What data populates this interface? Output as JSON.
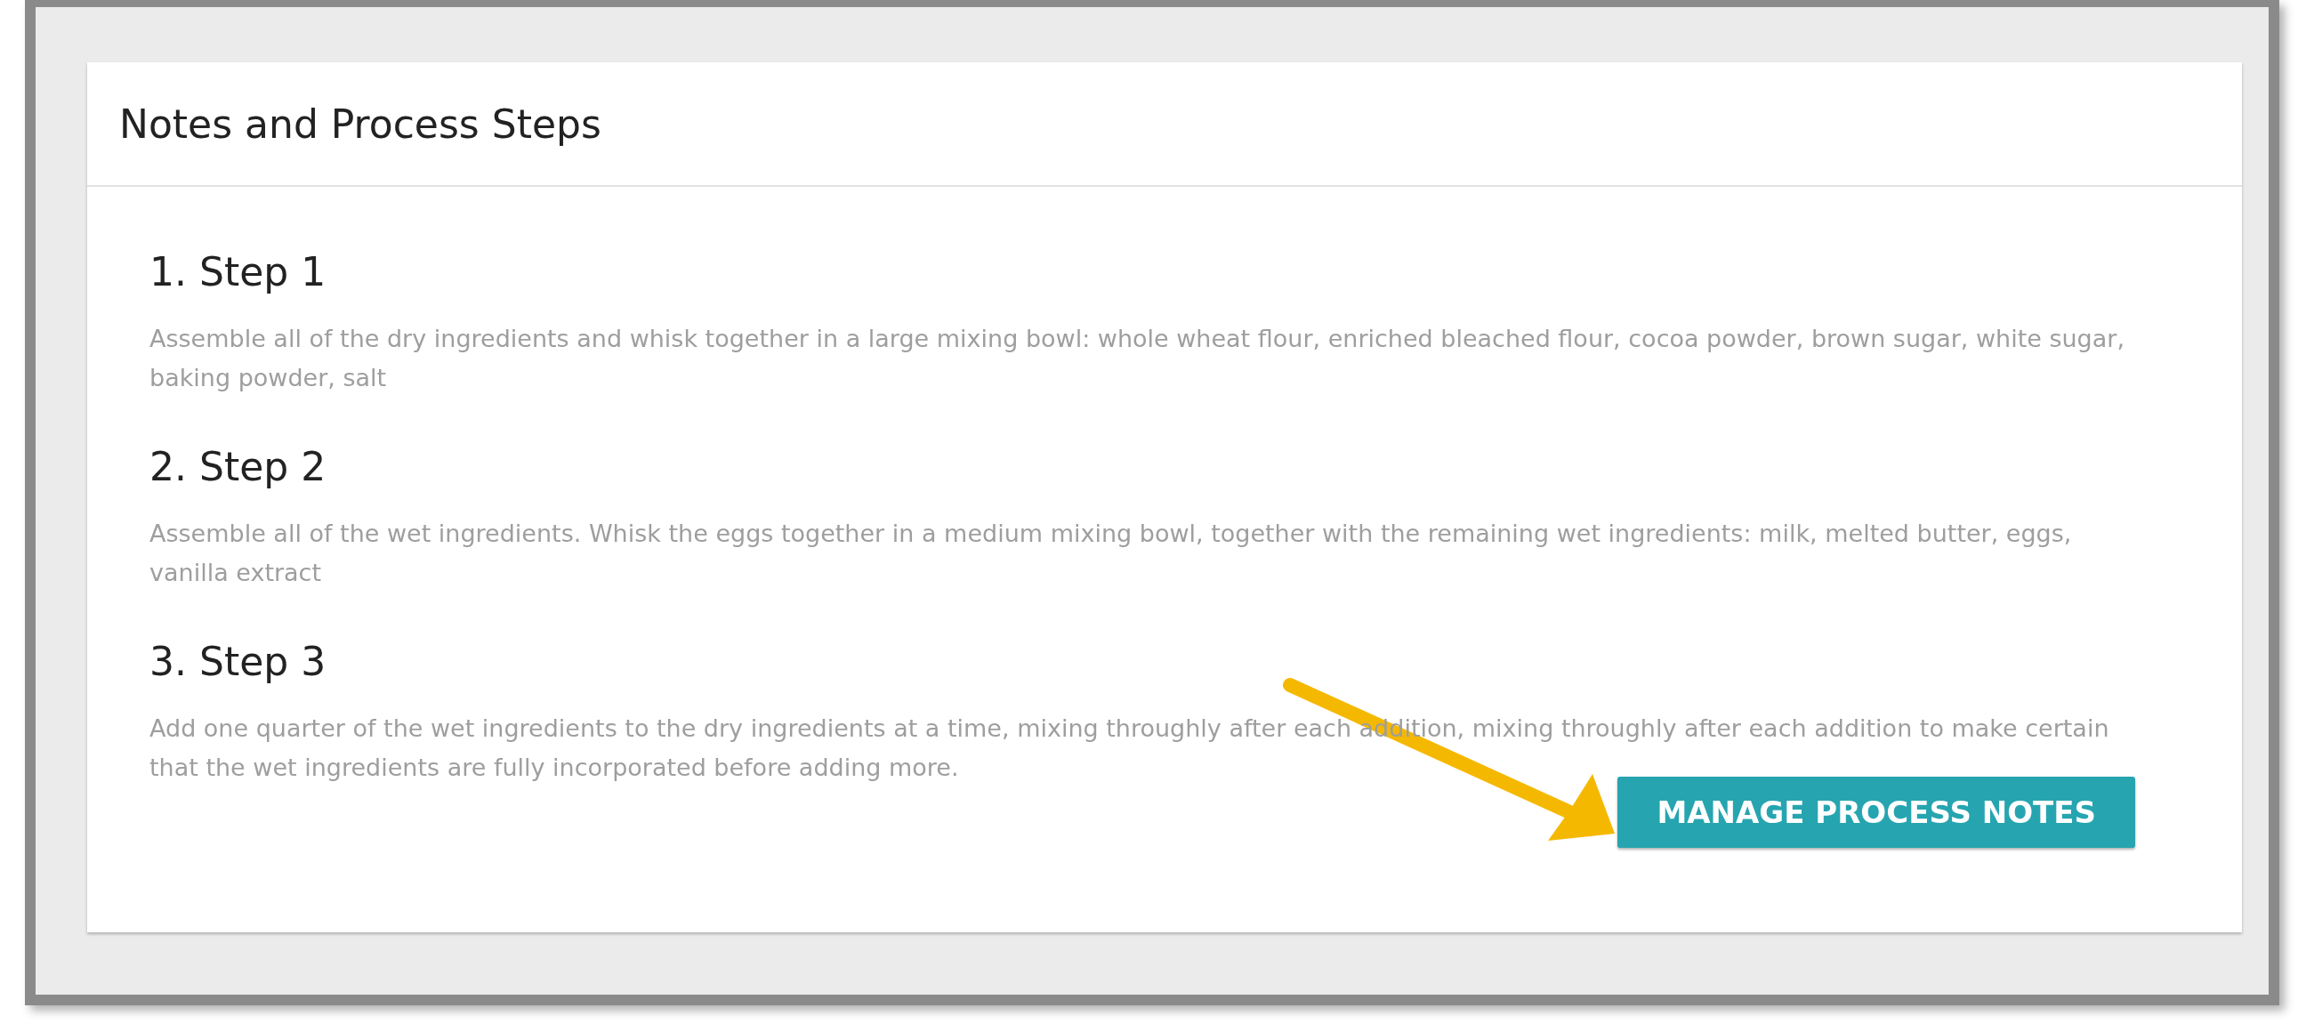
{
  "card": {
    "title": "Notes and Process Steps"
  },
  "steps": [
    {
      "heading": "1. Step 1",
      "text": "Assemble all of the dry ingredients and whisk together in a large mixing bowl: whole wheat flour, enriched bleached flour, cocoa powder, brown sugar, white sugar, baking powder, salt"
    },
    {
      "heading": "2. Step 2",
      "text": "Assemble all of the wet ingredients. Whisk the eggs together in a medium mixing bowl, together with the remaining wet ingredients: milk, melted butter, eggs, vanilla extract"
    },
    {
      "heading": "3. Step 3",
      "text": "Add one quarter of the wet ingredients to the dry ingredients at a time, mixing throughly after each addition, mixing throughly after each addition to make certain that the wet ingredients are fully incorporated before adding more."
    }
  ],
  "button": {
    "label": "MANAGE PROCESS NOTES"
  }
}
